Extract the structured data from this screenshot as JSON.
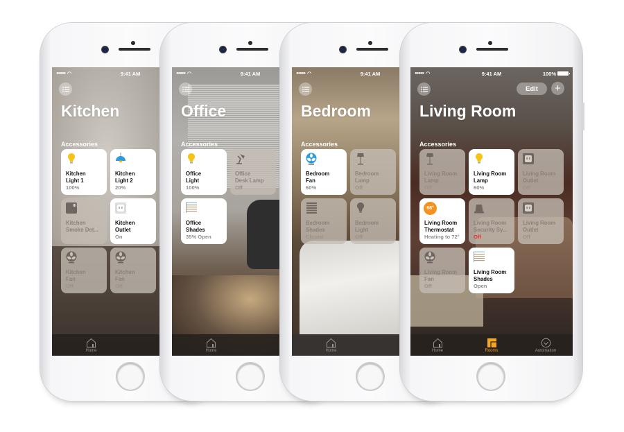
{
  "accent_color": "#f5a623",
  "alert_color": "#e8332c",
  "status_bar": {
    "signal": "●●●●●",
    "time": "9:41 AM",
    "battery": "100%"
  },
  "accessories_label": "Accessories",
  "tab_bar": {
    "home": "Home",
    "rooms": "Rooms",
    "automation": "Automation"
  },
  "phones": [
    {
      "room": "Kitchen",
      "tiles": [
        {
          "line1": "Kitchen",
          "line2": "Light 1",
          "state": "100%",
          "on": true,
          "icon": "lightbulb-icon"
        },
        {
          "line1": "Kitchen",
          "line2": "Light 2",
          "state": "20%",
          "on": true,
          "icon": "pendant-lamp-icon"
        },
        {
          "line1": "Kitchen",
          "line2": "Smoke Det...",
          "state": "",
          "on": false,
          "icon": "smoke-detector-icon"
        },
        {
          "line1": "Kitchen",
          "line2": "Outlet",
          "state": "On",
          "on": true,
          "icon": "outlet-icon"
        },
        {
          "line1": "Kitchen",
          "line2": "Fan",
          "state": "Off",
          "on": false,
          "icon": "fan-icon"
        },
        {
          "line1": "Kitchen",
          "line2": "Fan",
          "state": "Off",
          "on": false,
          "icon": "fan-icon"
        }
      ]
    },
    {
      "room": "Office",
      "tiles": [
        {
          "line1": "Office",
          "line2": "Light",
          "state": "100%",
          "on": true,
          "icon": "lightbulb-icon"
        },
        {
          "line1": "Office",
          "line2": "Desk Lamp",
          "state": "Off",
          "on": false,
          "icon": "desk-lamp-icon"
        },
        {
          "line1": "Office",
          "line2": "Shades",
          "state": "35% Open",
          "on": true,
          "icon": "shades-icon"
        }
      ]
    },
    {
      "room": "Bedroom",
      "tiles": [
        {
          "line1": "Bedroom",
          "line2": "Fan",
          "state": "60%",
          "on": true,
          "icon": "fan-icon"
        },
        {
          "line1": "Bedroom",
          "line2": "Lamp",
          "state": "Off",
          "on": false,
          "icon": "floor-lamp-icon"
        },
        {
          "line1": "Bedroom",
          "line2": "Shades",
          "state": "Closed",
          "on": false,
          "icon": "shades-icon"
        },
        {
          "line1": "Bedroom",
          "line2": "Light",
          "state": "Off",
          "on": false,
          "icon": "lightbulb-icon"
        }
      ]
    },
    {
      "room": "Living Room",
      "edit_label": "Edit",
      "add_label": "+",
      "tiles": [
        {
          "line1": "Living Room",
          "line2": "Lamp",
          "state": "Off",
          "on": false,
          "icon": "floor-lamp-icon"
        },
        {
          "line1": "Living Room",
          "line2": "Lamp",
          "state": "60%",
          "on": true,
          "icon": "lightbulb-icon"
        },
        {
          "line1": "Living Room",
          "line2": "Outlet",
          "state": "Off",
          "on": false,
          "icon": "outlet-icon"
        },
        {
          "line1": "Living Room",
          "line2": "Thermostat",
          "state": "Heating to 72°",
          "on": true,
          "icon": "thermostat-icon",
          "badge": "68°"
        },
        {
          "line1": "Living Room",
          "line2": "Security Sy...",
          "state": "Off",
          "on": false,
          "icon": "security-alarm-icon",
          "alert": true
        },
        {
          "line1": "Living Room",
          "line2": "Outlet",
          "state": "Off",
          "on": false,
          "icon": "outlet-icon"
        },
        {
          "line1": "Living Room",
          "line2": "Fan",
          "state": "Off",
          "on": false,
          "icon": "fan-icon"
        },
        {
          "line1": "Living Room",
          "line2": "Shades",
          "state": "Open",
          "on": true,
          "icon": "shades-icon"
        }
      ]
    }
  ]
}
